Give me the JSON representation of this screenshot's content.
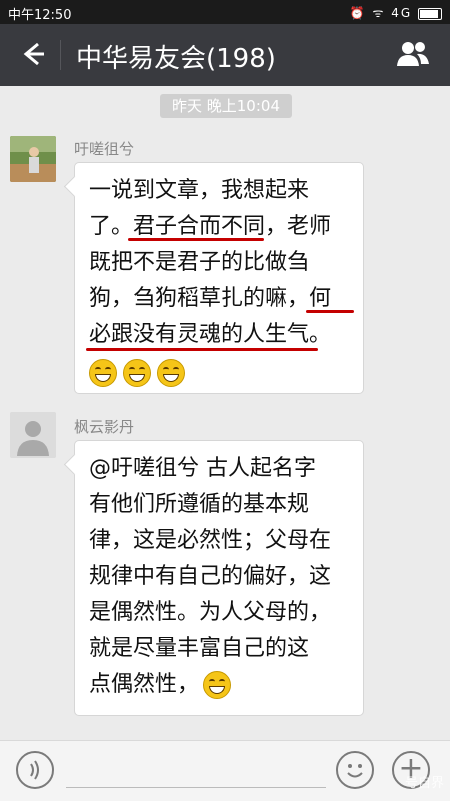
{
  "status": {
    "time": "中午12:50",
    "icons": "⏰ ᯤ 4G"
  },
  "header": {
    "back_icon": "back-arrow-icon",
    "title": "中华易友会(198)",
    "group_icon": "group-members-icon"
  },
  "timestamp": "昨天 晚上10:04",
  "messages": [
    {
      "sender": "吁嗟徂兮",
      "lines": [
        "一说到文章，我想起来",
        "了。君子合而不同，老师",
        "既把不是君子的比做刍",
        "狗，刍狗稻草扎的嘛，何",
        "必跟没有灵魂的人生气。"
      ],
      "emoji": [
        "grin-emoji",
        "grin-emoji",
        "grin-emoji"
      ]
    },
    {
      "sender": "枫云影丹",
      "lines": [
        "@吁嗟徂兮 古人起名字",
        "有他们所遵循的基本规",
        "律，这是必然性；父母在",
        "规律中有自己的偏好，这",
        "是偶然性。为人父母的，",
        "就是尽量丰富自己的这",
        "点偶然性，"
      ],
      "emoji": [
        "grin-emoji"
      ]
    }
  ],
  "bottom": {
    "voice_icon": "voice-icon",
    "emoji_icon": "emoji-icon",
    "plus_icon": "plus-icon"
  },
  "watermark": "号自界",
  "colors": {
    "appbar": "#393a3f",
    "underline": "#c40000",
    "background": "#ebebeb"
  }
}
